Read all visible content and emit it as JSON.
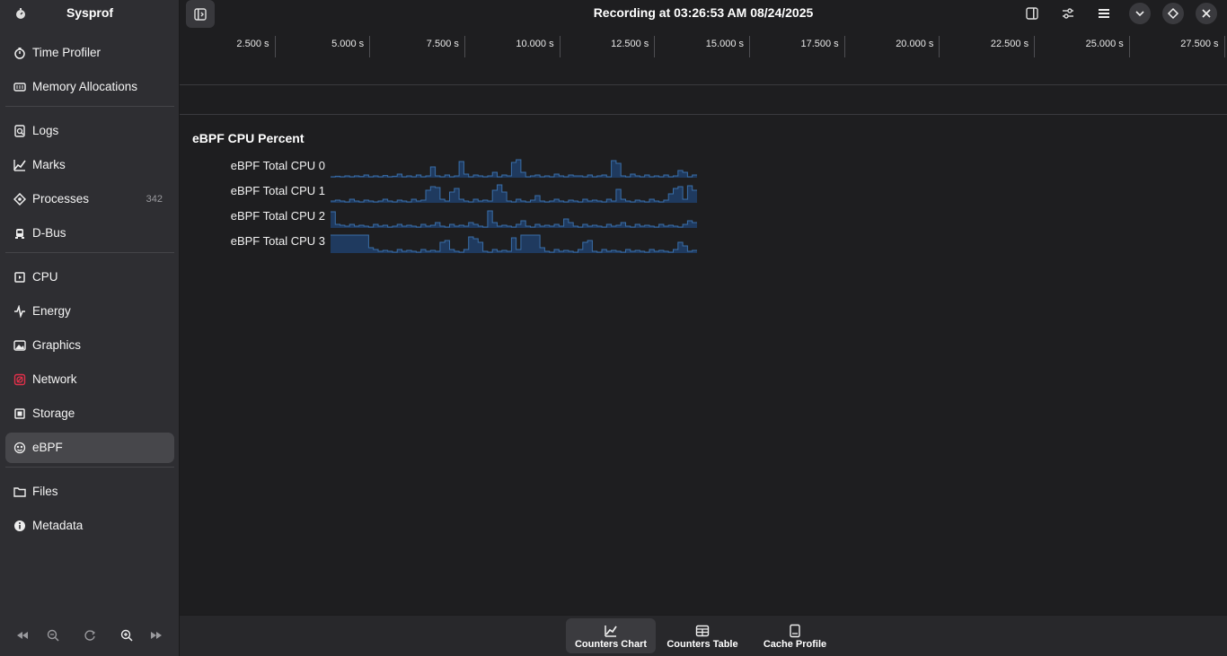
{
  "app": {
    "title": "Sysprof"
  },
  "sidebar": {
    "groups": [
      [
        {
          "label": "Time Profiler",
          "icon": "stopwatch-icon"
        },
        {
          "label": "Memory Allocations",
          "icon": "memory-icon"
        }
      ],
      [
        {
          "label": "Logs",
          "icon": "logs-icon"
        },
        {
          "label": "Marks",
          "icon": "marks-icon"
        },
        {
          "label": "Processes",
          "icon": "processes-icon",
          "count": "342"
        },
        {
          "label": "D-Bus",
          "icon": "dbus-icon"
        }
      ],
      [
        {
          "label": "CPU",
          "icon": "cpu-icon"
        },
        {
          "label": "Energy",
          "icon": "energy-icon"
        },
        {
          "label": "Graphics",
          "icon": "graphics-icon"
        },
        {
          "label": "Network",
          "icon": "network-icon",
          "color": "#e0304a"
        },
        {
          "label": "Storage",
          "icon": "storage-icon"
        },
        {
          "label": "eBPF",
          "icon": "ebpf-icon",
          "selected": true
        }
      ],
      [
        {
          "label": "Files",
          "icon": "folder-icon"
        },
        {
          "label": "Metadata",
          "icon": "info-icon"
        }
      ]
    ],
    "zoom_controls": [
      "seek-backward-icon",
      "zoom-out-icon",
      "zoom-reset-icon",
      "zoom-in-icon",
      "seek-forward-icon"
    ]
  },
  "header": {
    "title": "Recording at 03:26:53 AM 08/24/2025",
    "buttons": [
      "sidebar-right-icon",
      "sliders-icon",
      "hamburger-menu-icon",
      "chevron-down-icon",
      "diamond-icon",
      "close-icon"
    ]
  },
  "ruler": {
    "ticks": [
      "2.500 s",
      "5.000 s",
      "7.500 s",
      "10.000 s",
      "12.500 s",
      "15.000 s",
      "17.500 s",
      "20.000 s",
      "22.500 s",
      "25.000 s",
      "27.500 s"
    ]
  },
  "chart": {
    "title": "eBPF CPU Percent",
    "rows": [
      {
        "label": "eBPF Total CPU 0"
      },
      {
        "label": "eBPF Total CPU 1"
      },
      {
        "label": "eBPF Total CPU 2"
      },
      {
        "label": "eBPF Total CPU 3"
      }
    ],
    "colors": {
      "fill": "#1f3a5f",
      "stroke": "#3a6ea8"
    }
  },
  "chart_data": {
    "type": "area",
    "title": "eBPF CPU Percent",
    "xlabel": "",
    "ylabel": "",
    "series": [
      {
        "name": "eBPF Total CPU 0",
        "values": [
          0.05,
          0.08,
          0.05,
          0.1,
          0.05,
          0.1,
          0.06,
          0.15,
          0.05,
          0.1,
          0.05,
          0.12,
          0.05,
          0.08,
          0.2,
          0.05,
          0.1,
          0.05,
          0.15,
          0.05,
          0.1,
          0.6,
          0.1,
          0.05,
          0.15,
          0.05,
          0.1,
          0.9,
          0.2,
          0.05,
          0.15,
          0.1,
          0.05,
          0.1,
          0.3,
          0.05,
          0.15,
          0.1,
          0.85,
          1.0,
          0.3,
          0.05,
          0.1,
          0.15,
          0.05,
          0.1,
          0.05,
          0.2,
          0.1,
          0.05,
          0.15,
          0.1,
          0.1,
          0.05,
          0.15,
          0.05,
          0.1,
          0.15,
          0.05,
          0.95,
          0.8,
          0.1,
          0.05,
          0.2,
          0.1,
          0.05,
          0.15,
          0.05,
          0.1,
          0.05,
          0.15,
          0.05,
          0.1,
          0.4,
          0.3,
          0.05,
          0.15
        ]
      },
      {
        "name": "eBPF Total CPU 1",
        "values": [
          0.1,
          0.15,
          0.1,
          0.05,
          0.2,
          0.1,
          0.05,
          0.15,
          0.1,
          0.05,
          0.1,
          0.2,
          0.1,
          0.05,
          0.15,
          0.1,
          0.05,
          0.2,
          0.1,
          0.15,
          0.7,
          0.9,
          0.85,
          0.2,
          0.1,
          0.6,
          0.8,
          0.2,
          0.1,
          0.05,
          0.2,
          0.1,
          0.15,
          0.1,
          0.7,
          1.0,
          0.6,
          0.1,
          0.05,
          0.2,
          0.1,
          0.05,
          0.15,
          0.4,
          0.1,
          0.05,
          0.1,
          0.2,
          0.1,
          0.05,
          0.15,
          0.1,
          0.05,
          0.2,
          0.1,
          0.15,
          0.1,
          0.05,
          0.2,
          0.1,
          0.75,
          0.2,
          0.1,
          0.05,
          0.15,
          0.1,
          0.05,
          0.2,
          0.1,
          0.05,
          0.15,
          0.5,
          0.8,
          0.9,
          0.2,
          0.95,
          0.7
        ]
      },
      {
        "name": "eBPF Total CPU 2",
        "values": [
          0.9,
          0.2,
          0.15,
          0.1,
          0.2,
          0.1,
          0.15,
          0.1,
          0.05,
          0.2,
          0.1,
          0.15,
          0.05,
          0.1,
          0.2,
          0.1,
          0.15,
          0.1,
          0.05,
          0.2,
          0.1,
          0.15,
          0.3,
          0.1,
          0.05,
          0.2,
          0.1,
          0.15,
          0.1,
          0.3,
          0.2,
          0.1,
          0.05,
          0.95,
          0.3,
          0.1,
          0.15,
          0.1,
          0.05,
          0.2,
          0.4,
          0.1,
          0.05,
          0.2,
          0.1,
          0.15,
          0.1,
          0.2,
          0.1,
          0.5,
          0.3,
          0.1,
          0.05,
          0.2,
          0.1,
          0.15,
          0.1,
          0.05,
          0.2,
          0.1,
          0.15,
          0.3,
          0.1,
          0.05,
          0.2,
          0.1,
          0.15,
          0.1,
          0.05,
          0.2,
          0.1,
          0.15,
          0.1,
          0.05,
          0.2,
          0.4,
          0.3
        ]
      },
      {
        "name": "eBPF Total CPU 3",
        "values": [
          1.0,
          1.0,
          1.0,
          1.0,
          1.0,
          1.0,
          1.0,
          1.0,
          0.3,
          0.2,
          0.1,
          0.15,
          0.1,
          0.05,
          0.2,
          0.1,
          0.15,
          0.1,
          0.05,
          0.2,
          0.1,
          0.15,
          0.1,
          0.6,
          0.7,
          0.2,
          0.1,
          0.05,
          0.2,
          0.9,
          0.8,
          0.6,
          0.1,
          0.05,
          0.2,
          0.1,
          0.15,
          0.1,
          0.85,
          0.2,
          1.0,
          1.0,
          1.0,
          1.0,
          0.3,
          0.1,
          0.05,
          0.2,
          0.1,
          0.15,
          0.1,
          0.05,
          0.2,
          0.6,
          0.7,
          0.1,
          0.05,
          0.2,
          0.1,
          0.15,
          0.1,
          0.05,
          0.2,
          0.1,
          0.15,
          0.1,
          0.05,
          0.2,
          0.1,
          0.15,
          0.1,
          0.05,
          0.2,
          0.6,
          0.4,
          0.1,
          0.15
        ]
      }
    ]
  },
  "switcher": {
    "items": [
      {
        "label": "Counters Chart",
        "icon": "chart-icon",
        "active": true
      },
      {
        "label": "Counters Table",
        "icon": "table-icon"
      },
      {
        "label": "Cache Profile",
        "icon": "cache-icon"
      }
    ]
  }
}
